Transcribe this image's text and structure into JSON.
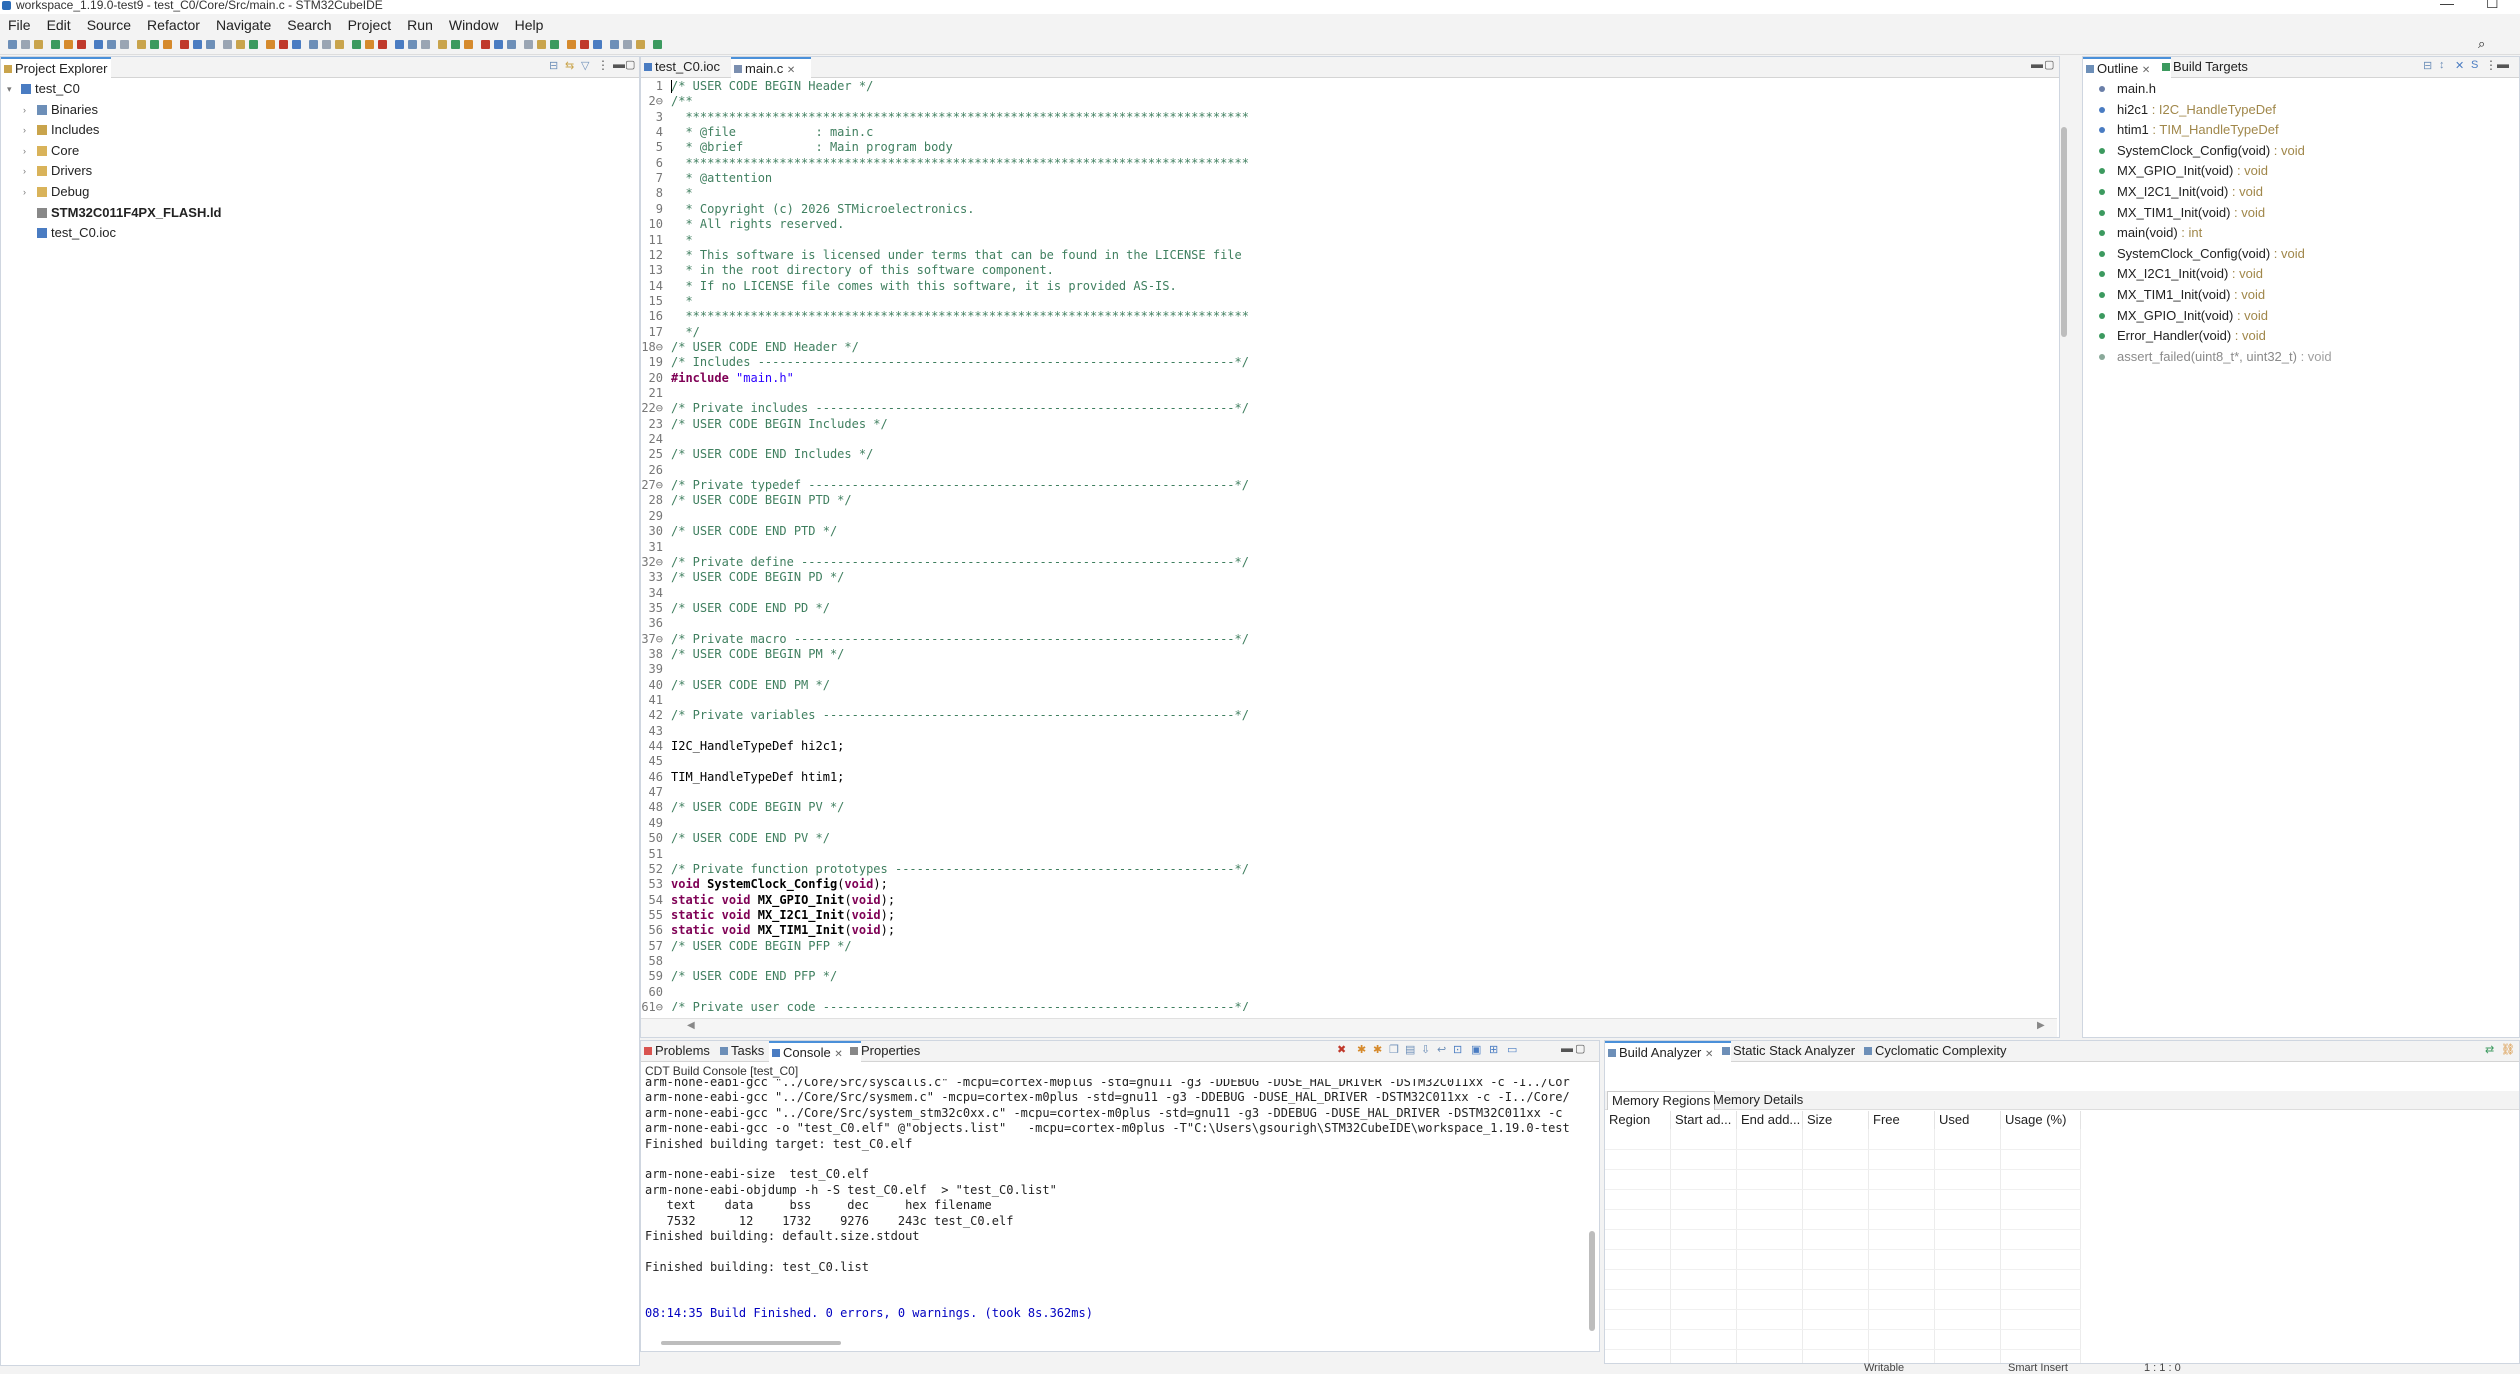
{
  "window": {
    "title": "workspace_1.19.0-test9 - test_C0/Core/Src/main.c - STM32CubeIDE",
    "minimize": "—",
    "maximize": "☐"
  },
  "menu": [
    "File",
    "Edit",
    "Source",
    "Refactor",
    "Navigate",
    "Search",
    "Project",
    "Run",
    "Window",
    "Help"
  ],
  "project_explorer": {
    "tab_label": "Project Explorer",
    "items": [
      {
        "label": "test_C0",
        "level": 0,
        "expanded": true,
        "icon": "project-icon"
      },
      {
        "label": "Binaries",
        "level": 1,
        "icon": "binaries-icon"
      },
      {
        "label": "Includes",
        "level": 1,
        "icon": "includes-icon"
      },
      {
        "label": "Core",
        "level": 1,
        "icon": "folder-icon"
      },
      {
        "label": "Drivers",
        "level": 1,
        "icon": "folder-icon"
      },
      {
        "label": "Debug",
        "level": 1,
        "icon": "folder-icon"
      },
      {
        "label": "STM32C011F4PX_FLASH.ld",
        "level": 1,
        "icon": "linker-file-icon",
        "bold": true
      },
      {
        "label": "test_C0.ioc",
        "level": 1,
        "icon": "ioc-file-icon"
      }
    ]
  },
  "editor": {
    "tabs": [
      {
        "label": "test_C0.ioc",
        "active": false
      },
      {
        "label": "main.c",
        "active": true,
        "close": "✕"
      }
    ],
    "lines": [
      {
        "n": "1",
        "t": "/* USER CODE BEGIN Header */",
        "k": "cm"
      },
      {
        "n": "2⊖",
        "t": "/**",
        "k": "cm"
      },
      {
        "n": "3",
        "t": "  ******************************************************************************",
        "k": "cm"
      },
      {
        "n": "4",
        "t": "  * @file           : main.c",
        "k": "cm"
      },
      {
        "n": "5",
        "t": "  * @brief          : Main program body",
        "k": "cm"
      },
      {
        "n": "6",
        "t": "  ******************************************************************************",
        "k": "cm"
      },
      {
        "n": "7",
        "t": "  * @attention",
        "k": "cm"
      },
      {
        "n": "8",
        "t": "  *",
        "k": "cm"
      },
      {
        "n": "9",
        "t": "  * Copyright (c) 2026 STMicroelectronics.",
        "k": "cm"
      },
      {
        "n": "10",
        "t": "  * All rights reserved.",
        "k": "cm"
      },
      {
        "n": "11",
        "t": "  *",
        "k": "cm"
      },
      {
        "n": "12",
        "t": "  * This software is licensed under terms that can be found in the LICENSE file",
        "k": "cm"
      },
      {
        "n": "13",
        "t": "  * in the root directory of this software component.",
        "k": "cm"
      },
      {
        "n": "14",
        "t": "  * If no LICENSE file comes with this software, it is provided AS-IS.",
        "k": "cm"
      },
      {
        "n": "15",
        "t": "  *",
        "k": "cm"
      },
      {
        "n": "16",
        "t": "  ******************************************************************************",
        "k": "cm"
      },
      {
        "n": "17",
        "t": "  */",
        "k": "cm"
      },
      {
        "n": "18⊖",
        "t": "/* USER CODE END Header */",
        "k": "cm"
      },
      {
        "n": "19",
        "t": "/* Includes ------------------------------------------------------------------*/",
        "k": "cm"
      },
      {
        "n": "20",
        "t": "#include \"main.h\"",
        "k": "inc"
      },
      {
        "n": "21",
        "t": "",
        "k": "pl"
      },
      {
        "n": "22⊖",
        "t": "/* Private includes ----------------------------------------------------------*/",
        "k": "cm"
      },
      {
        "n": "23",
        "t": "/* USER CODE BEGIN Includes */",
        "k": "cm"
      },
      {
        "n": "24",
        "t": "",
        "k": "pl"
      },
      {
        "n": "25",
        "t": "/* USER CODE END Includes */",
        "k": "cm"
      },
      {
        "n": "26",
        "t": "",
        "k": "pl"
      },
      {
        "n": "27⊖",
        "t": "/* Private typedef -----------------------------------------------------------*/",
        "k": "cm"
      },
      {
        "n": "28",
        "t": "/* USER CODE BEGIN PTD */",
        "k": "cm"
      },
      {
        "n": "29",
        "t": "",
        "k": "pl"
      },
      {
        "n": "30",
        "t": "/* USER CODE END PTD */",
        "k": "cm"
      },
      {
        "n": "31",
        "t": "",
        "k": "pl"
      },
      {
        "n": "32⊖",
        "t": "/* Private define ------------------------------------------------------------*/",
        "k": "cm"
      },
      {
        "n": "33",
        "t": "/* USER CODE BEGIN PD */",
        "k": "cm"
      },
      {
        "n": "34",
        "t": "",
        "k": "pl"
      },
      {
        "n": "35",
        "t": "/* USER CODE END PD */",
        "k": "cm"
      },
      {
        "n": "36",
        "t": "",
        "k": "pl"
      },
      {
        "n": "37⊖",
        "t": "/* Private macro -------------------------------------------------------------*/",
        "k": "cm"
      },
      {
        "n": "38",
        "t": "/* USER CODE BEGIN PM */",
        "k": "cm"
      },
      {
        "n": "39",
        "t": "",
        "k": "pl"
      },
      {
        "n": "40",
        "t": "/* USER CODE END PM */",
        "k": "cm"
      },
      {
        "n": "41",
        "t": "",
        "k": "pl"
      },
      {
        "n": "42",
        "t": "/* Private variables ---------------------------------------------------------*/",
        "k": "cm"
      },
      {
        "n": "43",
        "t": "",
        "k": "pl"
      },
      {
        "n": "44",
        "t": "I2C_HandleTypeDef hi2c1;",
        "k": "pl"
      },
      {
        "n": "45",
        "t": "",
        "k": "pl"
      },
      {
        "n": "46",
        "t": "TIM_HandleTypeDef htim1;",
        "k": "pl"
      },
      {
        "n": "47",
        "t": "",
        "k": "pl"
      },
      {
        "n": "48",
        "t": "/* USER CODE BEGIN PV */",
        "k": "cm"
      },
      {
        "n": "49",
        "t": "",
        "k": "pl"
      },
      {
        "n": "50",
        "t": "/* USER CODE END PV */",
        "k": "cm"
      },
      {
        "n": "51",
        "t": "",
        "k": "pl"
      },
      {
        "n": "52",
        "t": "/* Private function prototypes -----------------------------------------------*/",
        "k": "cm"
      },
      {
        "n": "53",
        "t": "void SystemClock_Config(void);",
        "k": "fn"
      },
      {
        "n": "54",
        "t": "static void MX_GPIO_Init(void);",
        "k": "fn"
      },
      {
        "n": "55",
        "t": "static void MX_I2C1_Init(void);",
        "k": "fn"
      },
      {
        "n": "56",
        "t": "static void MX_TIM1_Init(void);",
        "k": "fn"
      },
      {
        "n": "57",
        "t": "/* USER CODE BEGIN PFP */",
        "k": "cm"
      },
      {
        "n": "58",
        "t": "",
        "k": "pl"
      },
      {
        "n": "59",
        "t": "/* USER CODE END PFP */",
        "k": "cm"
      },
      {
        "n": "60",
        "t": "",
        "k": "pl"
      },
      {
        "n": "61⊖",
        "t": "/* Private user code ---------------------------------------------------------*/",
        "k": "cm"
      }
    ]
  },
  "outline": {
    "tabs": [
      {
        "label": "Outline",
        "close": "✕"
      },
      {
        "label": "Build Targets"
      }
    ],
    "items": [
      {
        "name": "main.h",
        "type": "",
        "icon": "include-icon",
        "color": "#6a7fa8"
      },
      {
        "name": "hi2c1",
        "type": " : I2C_HandleTypeDef",
        "icon": "variable-icon",
        "color": "#4a7cc2"
      },
      {
        "name": "htim1",
        "type": " : TIM_HandleTypeDef",
        "icon": "variable-icon",
        "color": "#4a7cc2"
      },
      {
        "name": "SystemClock_Config(void)",
        "type": " : void",
        "icon": "function-icon",
        "color": "#3c9a5f"
      },
      {
        "name": "MX_GPIO_Init(void)",
        "type": " : void",
        "icon": "static-function-icon",
        "color": "#3c9a5f"
      },
      {
        "name": "MX_I2C1_Init(void)",
        "type": " : void",
        "icon": "static-function-icon",
        "color": "#3c9a5f"
      },
      {
        "name": "MX_TIM1_Init(void)",
        "type": " : void",
        "icon": "static-function-icon",
        "color": "#3c9a5f"
      },
      {
        "name": "main(void)",
        "type": " : int",
        "icon": "function-icon",
        "color": "#3c9a5f"
      },
      {
        "name": "SystemClock_Config(void)",
        "type": " : void",
        "icon": "function-icon",
        "color": "#3c9a5f"
      },
      {
        "name": "MX_I2C1_Init(void)",
        "type": " : void",
        "icon": "static-function-icon",
        "color": "#3c9a5f"
      },
      {
        "name": "MX_TIM1_Init(void)",
        "type": " : void",
        "icon": "static-function-icon",
        "color": "#3c9a5f"
      },
      {
        "name": "MX_GPIO_Init(void)",
        "type": " : void",
        "icon": "static-function-icon",
        "color": "#3c9a5f"
      },
      {
        "name": "Error_Handler(void)",
        "type": " : void",
        "icon": "function-icon",
        "color": "#3c9a5f"
      },
      {
        "name": "assert_failed(uint8_t*, uint32_t)",
        "type": " : void",
        "icon": "disabled-function-icon",
        "color": "#8aa99a",
        "muted": true
      }
    ]
  },
  "console": {
    "tabs": [
      {
        "label": "Problems"
      },
      {
        "label": "Tasks"
      },
      {
        "label": "Console",
        "active": true,
        "close": "✕"
      },
      {
        "label": "Properties"
      }
    ],
    "header": "CDT Build Console [test_C0]",
    "lines": [
      "arm-none-eabi-gcc \"../Core/Src/syscalls.c\" -mcpu=cortex-m0plus -std=gnu11 -g3 -DDEBUG -DUSE_HAL_DRIVER -DSTM32C011xx -c -I../Cor",
      "arm-none-eabi-gcc \"../Core/Src/sysmem.c\" -mcpu=cortex-m0plus -std=gnu11 -g3 -DDEBUG -DUSE_HAL_DRIVER -DSTM32C011xx -c -I../Core/",
      "arm-none-eabi-gcc \"../Core/Src/system_stm32c0xx.c\" -mcpu=cortex-m0plus -std=gnu11 -g3 -DDEBUG -DUSE_HAL_DRIVER -DSTM32C011xx -c",
      "arm-none-eabi-gcc -o \"test_C0.elf\" @\"objects.list\"   -mcpu=cortex-m0plus -T\"C:\\Users\\gsourigh\\STM32CubeIDE\\workspace_1.19.0-test",
      "Finished building target: test_C0.elf",
      "",
      "arm-none-eabi-size  test_C0.elf",
      "arm-none-eabi-objdump -h -S test_C0.elf  > \"test_C0.list\"",
      "   text    data     bss     dec     hex filename",
      "   7532      12    1732    9276    243c test_C0.elf",
      "Finished building: default.size.stdout",
      "",
      "Finished building: test_C0.list",
      "",
      "",
      "08:14:35 Build Finished. 0 errors, 0 warnings. (took 8s.362ms)"
    ]
  },
  "build_analyzer": {
    "tabs": [
      {
        "label": "Build Analyzer",
        "active": true,
        "close": "✕"
      },
      {
        "label": "Static Stack Analyzer"
      },
      {
        "label": "Cyclomatic Complexity"
      }
    ],
    "subtabs": [
      "Memory Regions",
      "Memory Details"
    ],
    "columns": [
      "Region",
      "Start ad...",
      "End add...",
      "Size",
      "Free",
      "Used",
      "Usage (%)"
    ]
  },
  "statusbar": {
    "writable": "Writable",
    "insert_mode": "Smart Insert",
    "position": "1 : 1 : 0"
  },
  "colors": {
    "accent": "#4a90d9",
    "comment": "#3f7f5f",
    "keyword": "#7f0055",
    "string": "#2a00ff",
    "success": "#0000c0"
  }
}
